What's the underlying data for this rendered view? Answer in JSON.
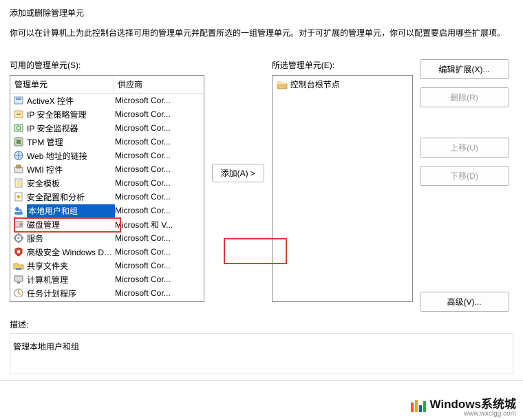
{
  "dialog": {
    "title": "添加或删除管理单元",
    "description": "你可以在计算机上为此控制台选择可用的管理单元并配置所选的一组管理单元。对于可扩展的管理单元，你可以配置要启用哪些扩展项。"
  },
  "available": {
    "label": "可用的管理单元(S):",
    "col_snapin": "管理单元",
    "col_vendor": "供应商",
    "items": [
      {
        "name": "ActiveX 控件",
        "vendor": "Microsoft Cor...",
        "icon": "activex"
      },
      {
        "name": "IP 安全策略管理",
        "vendor": "Microsoft Cor...",
        "icon": "ipsec"
      },
      {
        "name": "IP 安全监视器",
        "vendor": "Microsoft Cor...",
        "icon": "ipsecmon"
      },
      {
        "name": "TPM 管理",
        "vendor": "Microsoft Cor...",
        "icon": "tpm"
      },
      {
        "name": "Web 地址的链接",
        "vendor": "Microsoft Cor...",
        "icon": "weblink"
      },
      {
        "name": "WMI 控件",
        "vendor": "Microsoft Cor...",
        "icon": "wmi"
      },
      {
        "name": "安全模板",
        "vendor": "Microsoft Cor...",
        "icon": "sectpl"
      },
      {
        "name": "安全配置和分析",
        "vendor": "Microsoft Cor...",
        "icon": "seccfg"
      },
      {
        "name": "本地用户和组",
        "vendor": "Microsoft Cor...",
        "icon": "lusrmgr"
      },
      {
        "name": "磁盘管理",
        "vendor": "Microsoft 和 V...",
        "icon": "disk"
      },
      {
        "name": "服务",
        "vendor": "Microsoft Cor...",
        "icon": "services"
      },
      {
        "name": "高级安全 Windows De...",
        "vendor": "Microsoft Cor...",
        "icon": "firewall"
      },
      {
        "name": "共享文件夹",
        "vendor": "Microsoft Cor...",
        "icon": "shared"
      },
      {
        "name": "计算机管理",
        "vendor": "Microsoft Cor...",
        "icon": "compmgmt"
      },
      {
        "name": "任务计划程序",
        "vendor": "Microsoft Cor...",
        "icon": "tasksched"
      }
    ],
    "selected_index": 8
  },
  "add_button": "添加(A) >",
  "selected": {
    "label": "所选管理单元(E):",
    "root": "控制台根节点"
  },
  "side_buttons": {
    "edit_ext": "编辑扩展(X)...",
    "remove": "删除(R)",
    "move_up": "上移(U)",
    "move_down": "下移(D)",
    "advanced": "高级(V)..."
  },
  "description_section": {
    "label": "描述:",
    "text": "管理本地用户和组"
  },
  "watermark": {
    "text": "Windows系统城",
    "url": "www.wxclgg.com"
  }
}
